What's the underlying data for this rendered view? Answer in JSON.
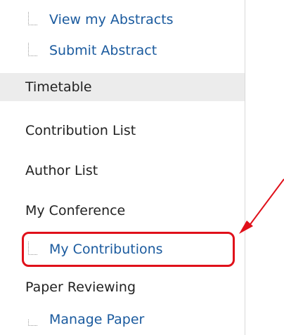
{
  "menu": {
    "view_abstracts": "View my Abstracts",
    "submit_abstract": "Submit Abstract",
    "timetable": "Timetable",
    "contribution_list": "Contribution List",
    "author_list": "Author List",
    "my_conference": "My Conference",
    "my_contributions": "My Contributions",
    "paper_reviewing": "Paper Reviewing",
    "manage_paper": "Manage Paper"
  },
  "colors": {
    "link": "#1a5a9e",
    "active_bg": "#ececec",
    "annotation": "#e0101a"
  }
}
